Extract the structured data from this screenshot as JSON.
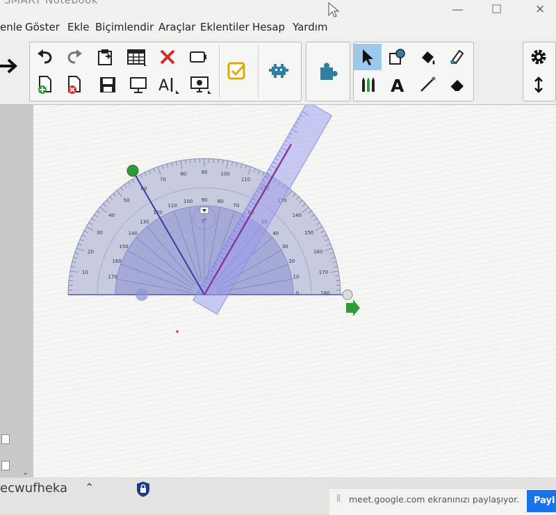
{
  "window": {
    "title": "SMART Notebook",
    "minimize_glyph": "—",
    "maximize_glyph": "☐",
    "close_glyph": "✕"
  },
  "menu": {
    "items": [
      "enle",
      "Göster",
      "Ekle",
      "Biçimlendir",
      "Araçlar",
      "Eklentiler",
      "Hesap",
      "Yardım"
    ]
  },
  "toolbar": {
    "icons": {
      "next_page": "arrow-right-icon",
      "undo": "undo-icon",
      "redo": "redo-icon",
      "paste": "paste-icon",
      "table": "table-icon",
      "delete": "delete-icon",
      "screen_shade": "screen-shade-icon",
      "add_page": "add-page-icon",
      "delete_page": "delete-page-icon",
      "save": "save-icon",
      "display": "display-icon",
      "text_tools": "text-tools-icon",
      "screen_capture": "screen-capture-icon",
      "response": "response-icon",
      "lab": "lab-icon",
      "addons": "puzzle-icon",
      "select": "select-pointer-icon",
      "shape": "shape-icon",
      "fill": "fill-icon",
      "highlighter": "highlighter-icon",
      "pens": "pens-icon",
      "text": "text-icon",
      "line": "line-icon",
      "eraser": "eraser-icon",
      "settings": "gear-icon",
      "move_toolbar": "move-vertical-icon"
    },
    "text_tool_glyph": "A",
    "text_tools_glyph": "A",
    "accent": "#1a3b8c",
    "selected_bg": "#9ec8ea"
  },
  "protractor": {
    "outer_labels": [
      "10",
      "20",
      "30",
      "40",
      "50",
      "60",
      "70",
      "80",
      "90",
      "100",
      "110",
      "120",
      "130",
      "140",
      "150",
      "160",
      "170",
      "180"
    ],
    "inner_labels": [
      "170",
      "160",
      "150",
      "140",
      "130",
      "120",
      "110",
      "100",
      "90",
      "80",
      "70",
      "60",
      "50",
      "40",
      "30",
      "20",
      "10",
      "0"
    ],
    "right_labels": [
      "140",
      "150",
      "160",
      "170",
      "180"
    ],
    "center_label": "0°",
    "angle_degrees": 120,
    "colors": {
      "body": "#b8bcd8",
      "inner": "#8b8fd0",
      "measure_line": "#3a3aa0",
      "ruler_line": "#8a3a9a",
      "handle_green": "#2e9a3a",
      "rotate_arrow": "#2d9d35"
    }
  },
  "bottom": {
    "meeting_code": "ecwufheka",
    "chevron": "⌃",
    "share_grip": "⦀",
    "share_text": "meet.google.com ekranınızı paylaşıyor.",
    "share_button": "Payl"
  }
}
